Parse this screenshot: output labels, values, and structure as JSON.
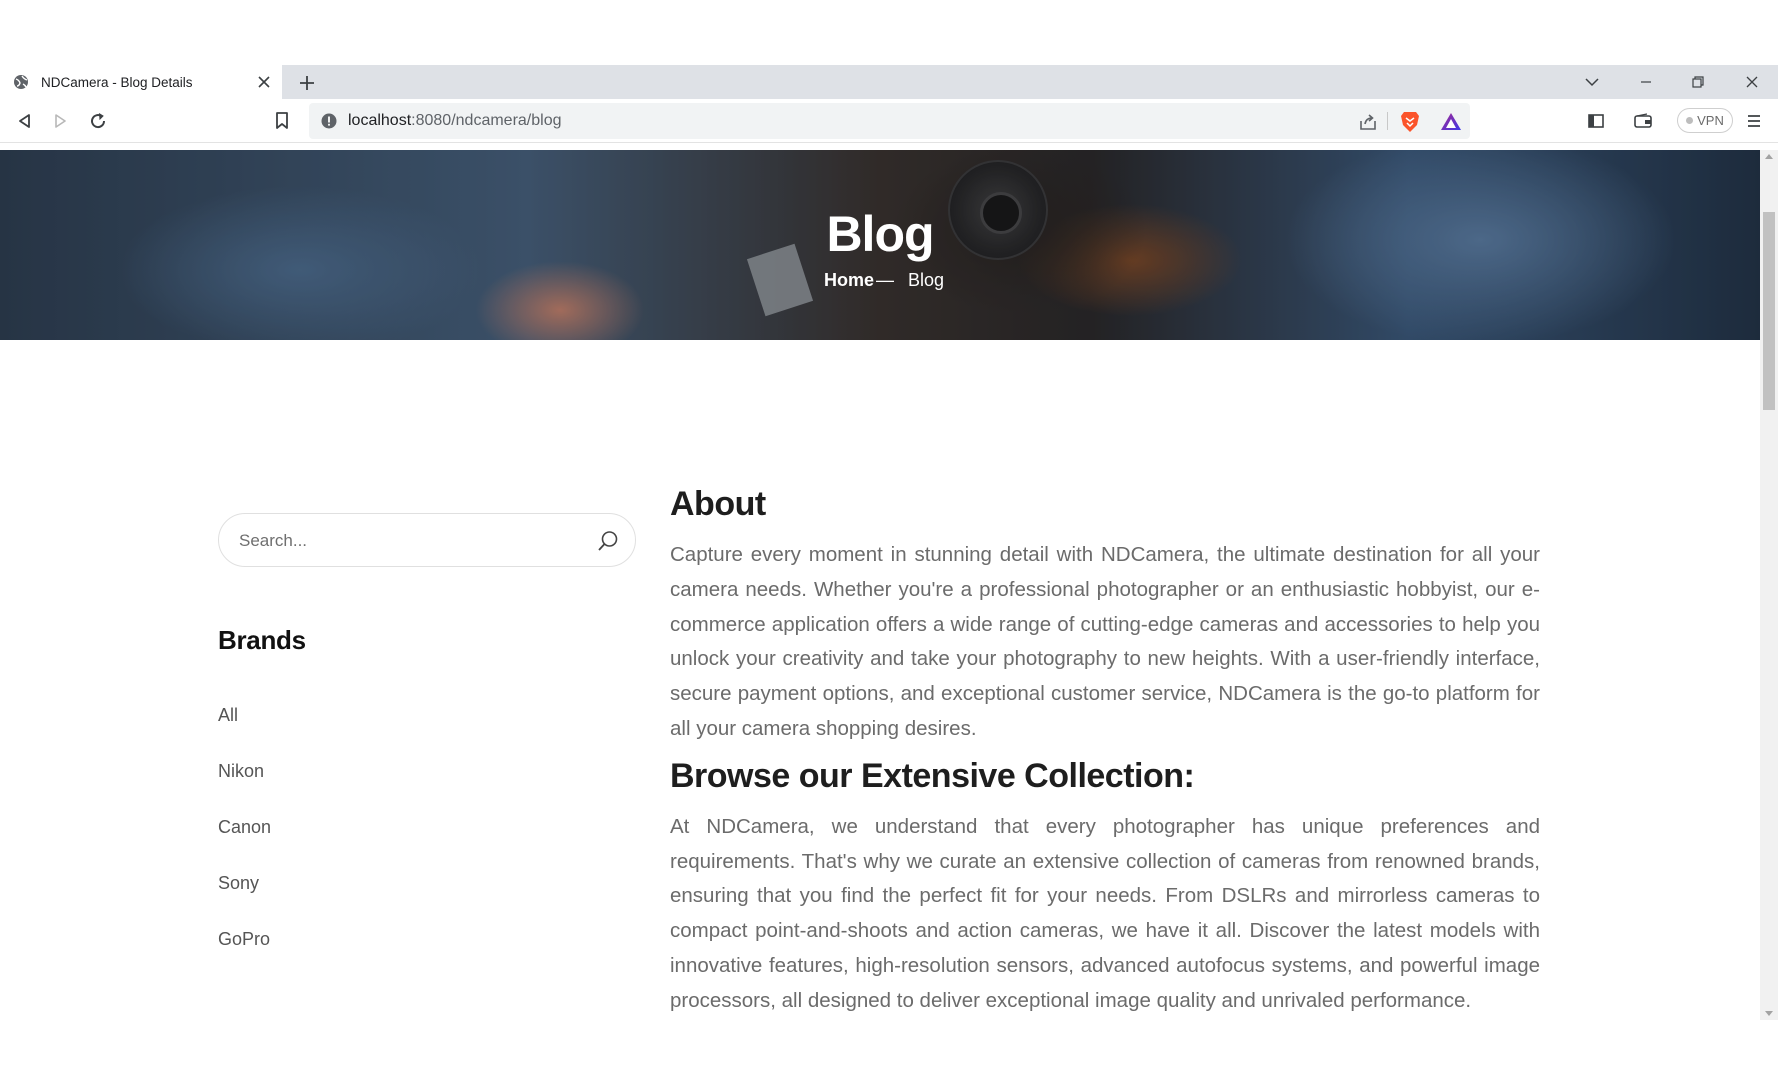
{
  "browser": {
    "tab_title": "NDCamera - Blog Details",
    "url_host": "localhost",
    "url_path": ":8080/ndcamera/blog",
    "vpn_label": "VPN"
  },
  "hero": {
    "title": "Blog",
    "breadcrumb_home": "Home",
    "breadcrumb_separator": "—",
    "breadcrumb_current": "Blog"
  },
  "sidebar": {
    "search_placeholder": "Search...",
    "brands_title": "Brands",
    "brands": [
      "All",
      "Nikon",
      "Canon",
      "Sony",
      "GoPro"
    ]
  },
  "content": {
    "about_title": "About",
    "about_text": "Capture every moment in stunning detail with NDCamera, the ultimate destination for all your camera needs. Whether you're a professional photographer or an enthusiastic hobbyist, our e-commerce application offers a wide range of cutting-edge cameras and accessories to help you unlock your creativity and take your photography to new heights. With a user-friendly interface, secure payment options, and exceptional customer service, NDCamera is the go-to platform for all your camera shopping desires.",
    "collection_title": "Browse our Extensive Collection:",
    "collection_text": "At NDCamera, we understand that every photographer has unique preferences and requirements. That's why we curate an extensive collection of cameras from renowned brands, ensuring that you find the perfect fit for your needs. From DSLRs and mirrorless cameras to compact point-and-shoots and action cameras, we have it all. Discover the latest models with innovative features, high-resolution sensors, advanced autofocus systems, and powerful image processors, all designed to deliver exceptional image quality and unrivaled performance."
  },
  "colors": {
    "tabstrip_bg": "#dee1e6",
    "omnibox_bg": "#f1f3f4",
    "heading_text": "#1e1e1e",
    "body_text": "#6b6b6b",
    "brave_orange": "#fb542b"
  }
}
